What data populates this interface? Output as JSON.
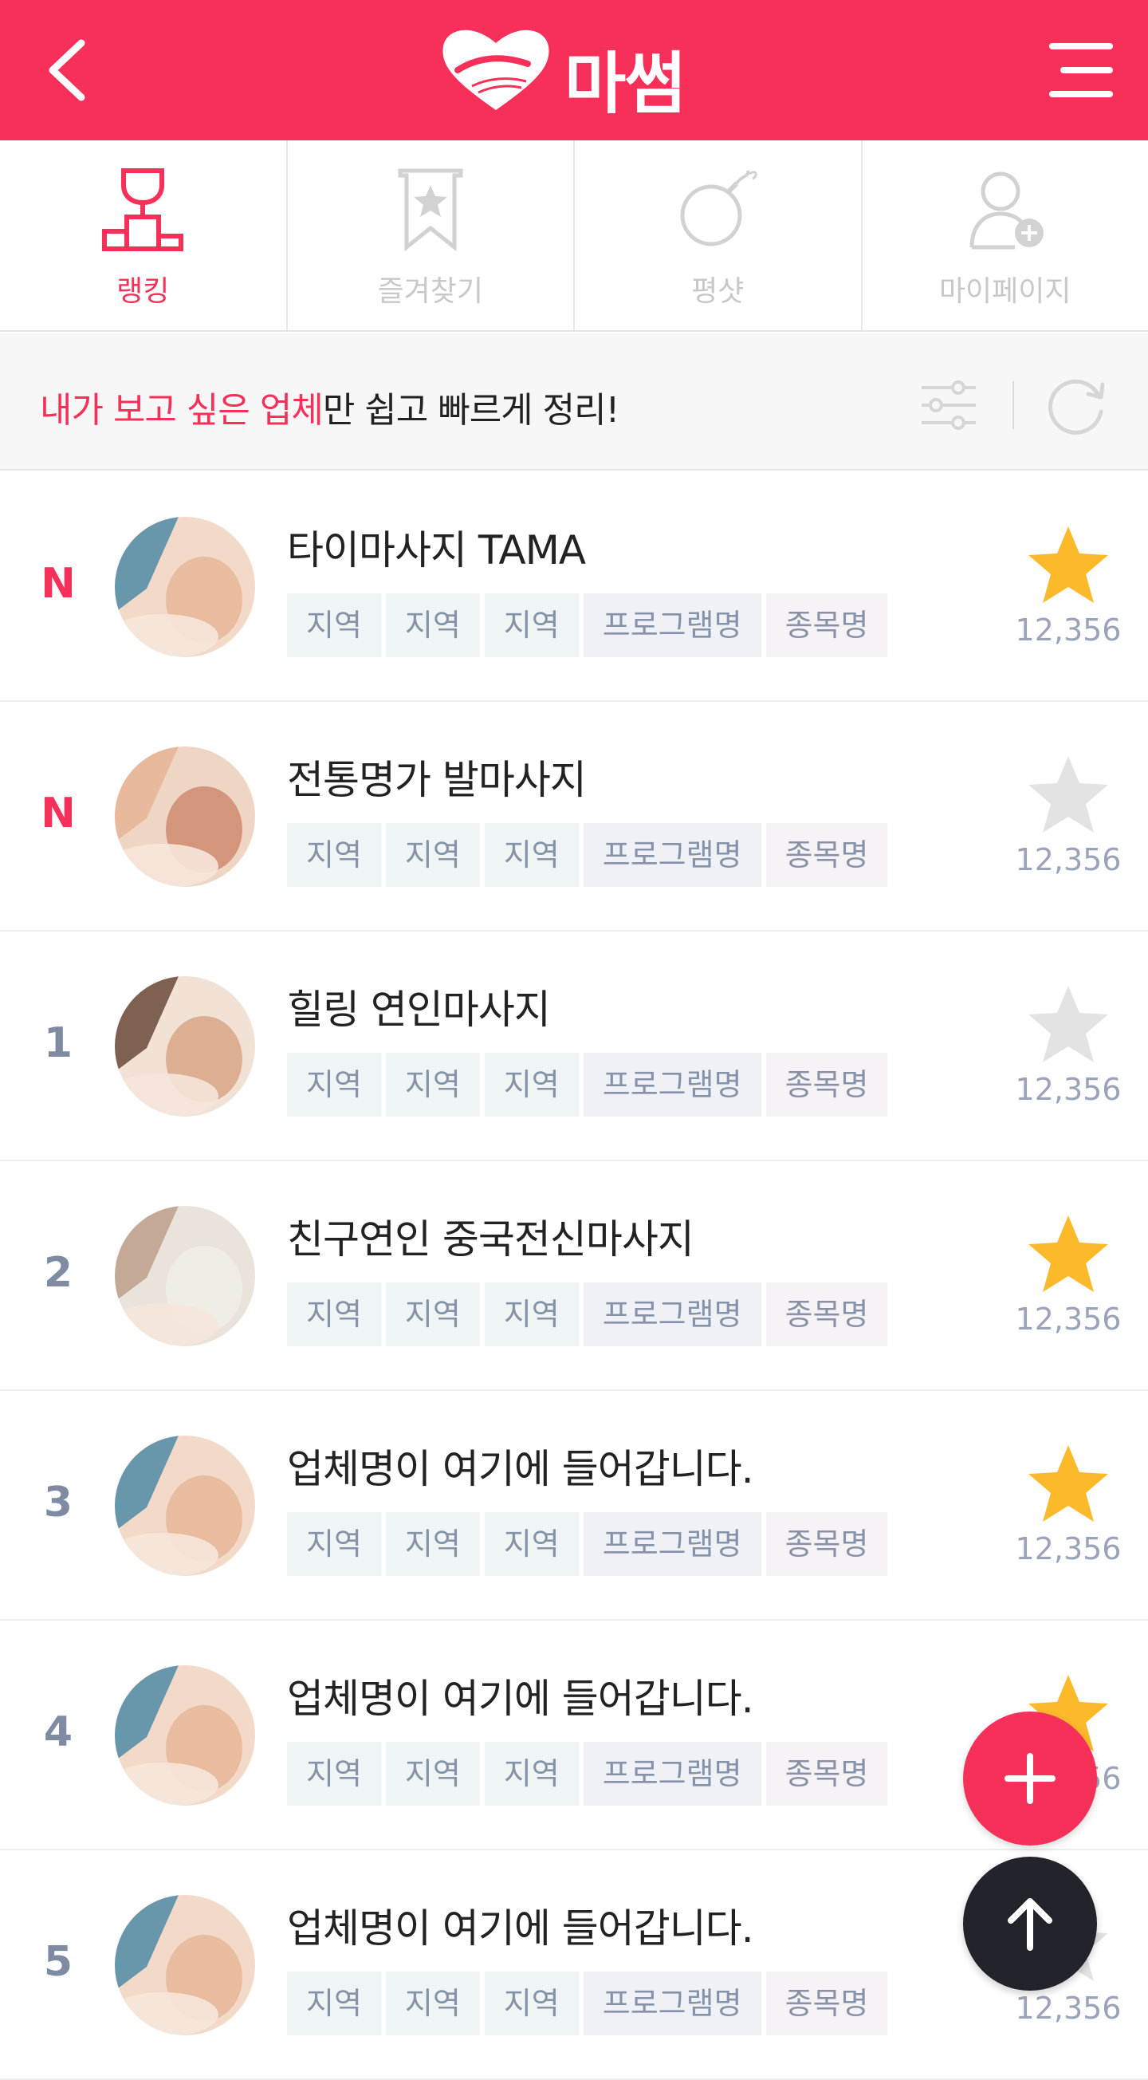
{
  "header": {
    "logo_text": "마썸",
    "back_icon": "chevron-left-icon",
    "menu_icon": "hamburger-menu-icon",
    "background": "#f7305a"
  },
  "tabs": [
    {
      "label": "랭킹",
      "icon": "trophy-icon",
      "active": true
    },
    {
      "label": "즐겨찾기",
      "icon": "bookmark-star-icon",
      "active": false
    },
    {
      "label": "평샷",
      "icon": "bomb-icon",
      "active": false
    },
    {
      "label": "마이페이지",
      "icon": "user-add-icon",
      "active": false
    }
  ],
  "banner": {
    "highlight": "내가 보고 싶은 업체",
    "rest": "만 쉽고 빠르게 정리!"
  },
  "list": [
    {
      "rank": "N",
      "is_new": true,
      "title": "타이마사지 TAMA",
      "tags": [
        "지역",
        "지역",
        "지역"
      ],
      "program": "프로그램명",
      "category": "종목명",
      "starred": true,
      "count": "12,356"
    },
    {
      "rank": "N",
      "is_new": true,
      "title": "전통명가 발마사지",
      "tags": [
        "지역",
        "지역",
        "지역"
      ],
      "program": "프로그램명",
      "category": "종목명",
      "starred": false,
      "count": "12,356"
    },
    {
      "rank": "1",
      "is_new": false,
      "title": "힐링 연인마사지",
      "tags": [
        "지역",
        "지역",
        "지역"
      ],
      "program": "프로그램명",
      "category": "종목명",
      "starred": false,
      "count": "12,356"
    },
    {
      "rank": "2",
      "is_new": false,
      "title": "친구연인 중국전신마사지",
      "tags": [
        "지역",
        "지역",
        "지역"
      ],
      "program": "프로그램명",
      "category": "종목명",
      "starred": true,
      "count": "12,356"
    },
    {
      "rank": "3",
      "is_new": false,
      "title": "업체명이 여기에 들어갑니다.",
      "tags": [
        "지역",
        "지역",
        "지역"
      ],
      "program": "프로그램명",
      "category": "종목명",
      "starred": true,
      "count": "12,356"
    },
    {
      "rank": "4",
      "is_new": false,
      "title": "업체명이 여기에 들어갑니다.",
      "tags": [
        "지역",
        "지역",
        "지역"
      ],
      "program": "프로그램명",
      "category": "종목명",
      "starred": true,
      "count": "12,356"
    },
    {
      "rank": "5",
      "is_new": false,
      "title": "업체명이 여기에 들어갑니다.",
      "tags": [
        "지역",
        "지역",
        "지역"
      ],
      "program": "프로그램명",
      "category": "종목명",
      "starred": false,
      "count": "12,356"
    }
  ],
  "fab": {
    "add_icon": "plus-icon",
    "top_icon": "arrow-up-icon"
  },
  "colors": {
    "accent": "#f7305a",
    "star_on": "#fcb92a",
    "star_off": "#e3e3e3",
    "rank": "#7f8aa3"
  }
}
